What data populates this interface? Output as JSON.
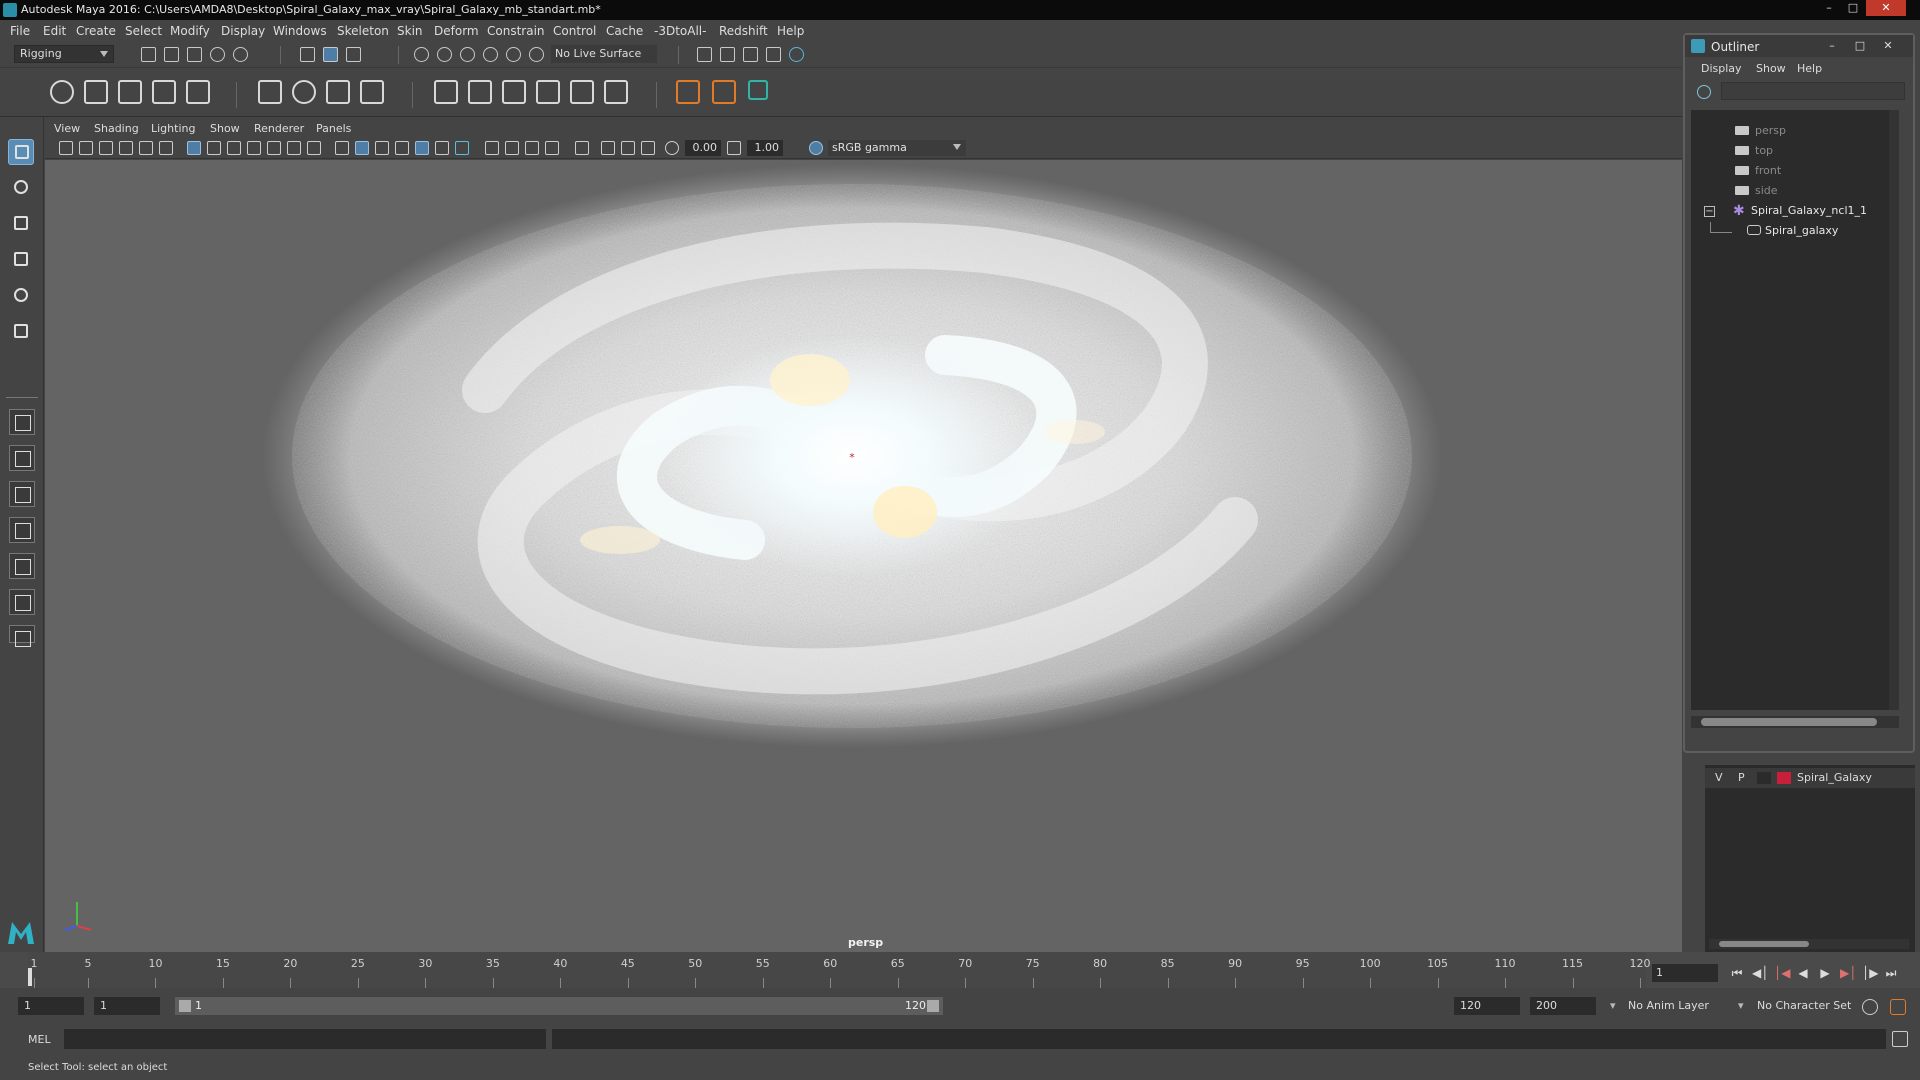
{
  "window": {
    "title": "Autodesk Maya 2016: C:\\Users\\AMDA8\\Desktop\\Spiral_Galaxy_max_vray\\Spiral_Galaxy_mb_standart.mb*"
  },
  "menubar": [
    "File",
    "Edit",
    "Create",
    "Select",
    "Modify",
    "Display",
    "Windows",
    "Skeleton",
    "Skin",
    "Deform",
    "Constrain",
    "Control",
    "Cache",
    "-3DtoAll-",
    "Redshift",
    "Help"
  ],
  "status_line": {
    "mode": "Rigging",
    "live_surface": "No Live Surface"
  },
  "panel": {
    "menus": [
      "View",
      "Shading",
      "Lighting",
      "Show",
      "Renderer",
      "Panels"
    ],
    "exposure": "0.00",
    "gamma": "1.00",
    "color_space": "sRGB gamma",
    "camera": "persp"
  },
  "outliner": {
    "title": "Outliner",
    "menus": [
      "Display",
      "Show",
      "Help"
    ],
    "items": [
      {
        "label": "persp",
        "icon": "camera-icon"
      },
      {
        "label": "top",
        "icon": "camera-icon"
      },
      {
        "label": "front",
        "icon": "camera-icon"
      },
      {
        "label": "side",
        "icon": "camera-icon"
      },
      {
        "label": "Spiral_Galaxy_ncl1_1",
        "icon": "nucleus-icon"
      },
      {
        "label": "Spiral_galaxy",
        "icon": "ncloth-icon"
      }
    ]
  },
  "layers": {
    "visible_flag": "V",
    "playback_flag": "P",
    "name": "Spiral_Galaxy",
    "color": "#c8203a"
  },
  "timeline": {
    "start": "1",
    "ticks": [
      "1",
      "5",
      "10",
      "15",
      "20",
      "25",
      "30",
      "35",
      "40",
      "45",
      "50",
      "55",
      "60",
      "65",
      "70",
      "75",
      "80",
      "85",
      "90",
      "95",
      "100",
      "105",
      "110",
      "115",
      "120"
    ],
    "current_frame": "1"
  },
  "range": {
    "start_time": "1",
    "playback_start": "1",
    "slider_start": "1",
    "slider_end": "120",
    "playback_end": "120",
    "end_time": "200",
    "anim_layer": "No Anim Layer",
    "character_set": "No Character Set"
  },
  "command_line": {
    "label": "MEL",
    "help": "Select Tool: select an object"
  },
  "colors": {
    "viewport_bg": "#646464",
    "accent": "#5a8db5"
  }
}
